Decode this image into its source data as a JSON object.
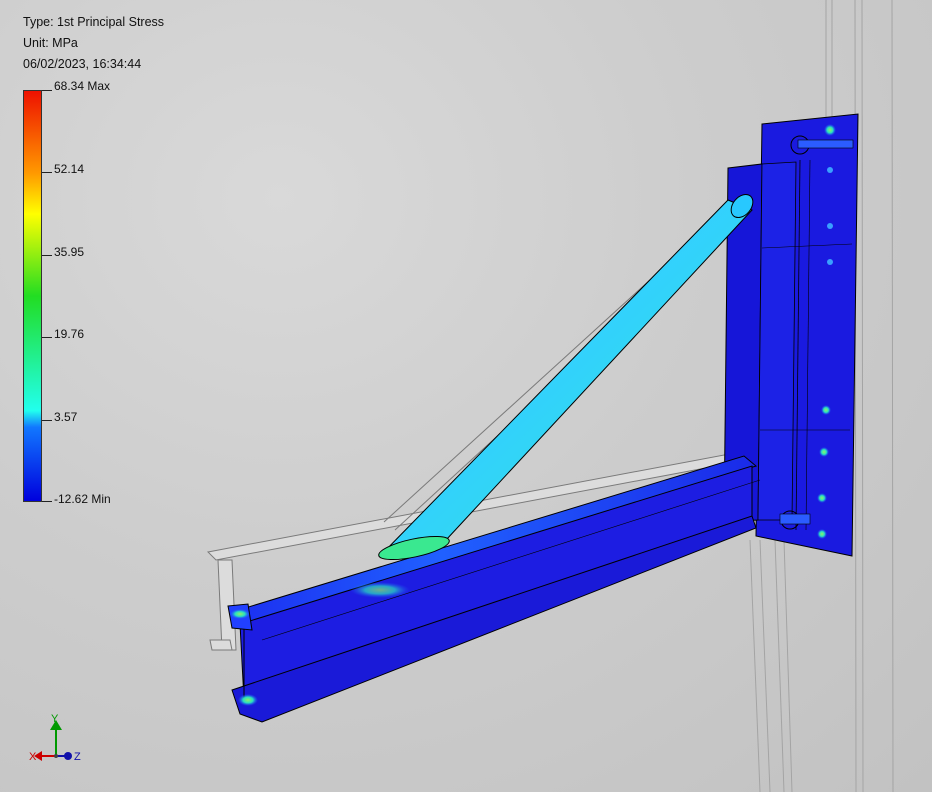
{
  "header": {
    "type_line": "Type: 1st Principal Stress",
    "unit_line": "Unit: MPa",
    "timestamp": "06/02/2023, 16:34:44"
  },
  "legend": {
    "labels": [
      "68.34 Max",
      "52.14",
      "35.95",
      "19.76",
      "3.57",
      "-12.62 Min"
    ],
    "colors": {
      "max": "#ee1100",
      "orange": "#ff9900",
      "yellow": "#ffff00",
      "green": "#22dd22",
      "cyan": "#22ffee",
      "blue_mid": "#1177ff",
      "min": "#0000dd"
    }
  },
  "triad": {
    "x_label": "X",
    "y_label": "Y",
    "z_label": "Z",
    "x_color": "#cc0000",
    "y_color": "#009900",
    "z_color": "#1111aa"
  },
  "model": {
    "beam_color": "#1a1ae6",
    "brace_color": "#2dc8ff",
    "highlight_color": "#3df0b0",
    "wire_color": "#8a8a8a"
  }
}
